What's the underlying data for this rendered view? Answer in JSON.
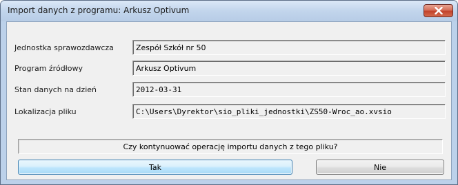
{
  "window": {
    "title": "Import danych z programu: Arkusz Optivum",
    "close_icon": "close-x-icon"
  },
  "fields": {
    "jednostka": {
      "label": "Jednostka sprawozdawcza",
      "value": "Zespół Szkół nr 50"
    },
    "program": {
      "label": "Program źródłowy",
      "value": "Arkusz Optivum"
    },
    "stan": {
      "label": "Stan danych na dzień",
      "value": "2012-03-31"
    },
    "lokalizacja": {
      "label": "Lokalizacja pliku",
      "value": "C:\\Users\\Dyrektor\\sio_pliki_jednostki\\ZS50-Wroc_ao.xvsio"
    }
  },
  "question": "Czy kontynuować operację importu danych z tego pliku?",
  "buttons": {
    "yes_label": "Tak",
    "no_label": "Nie"
  },
  "colors": {
    "close_button": "#c2422a",
    "default_button_border": "#3c7fb1",
    "dialog_background": "#f0f0f0"
  }
}
